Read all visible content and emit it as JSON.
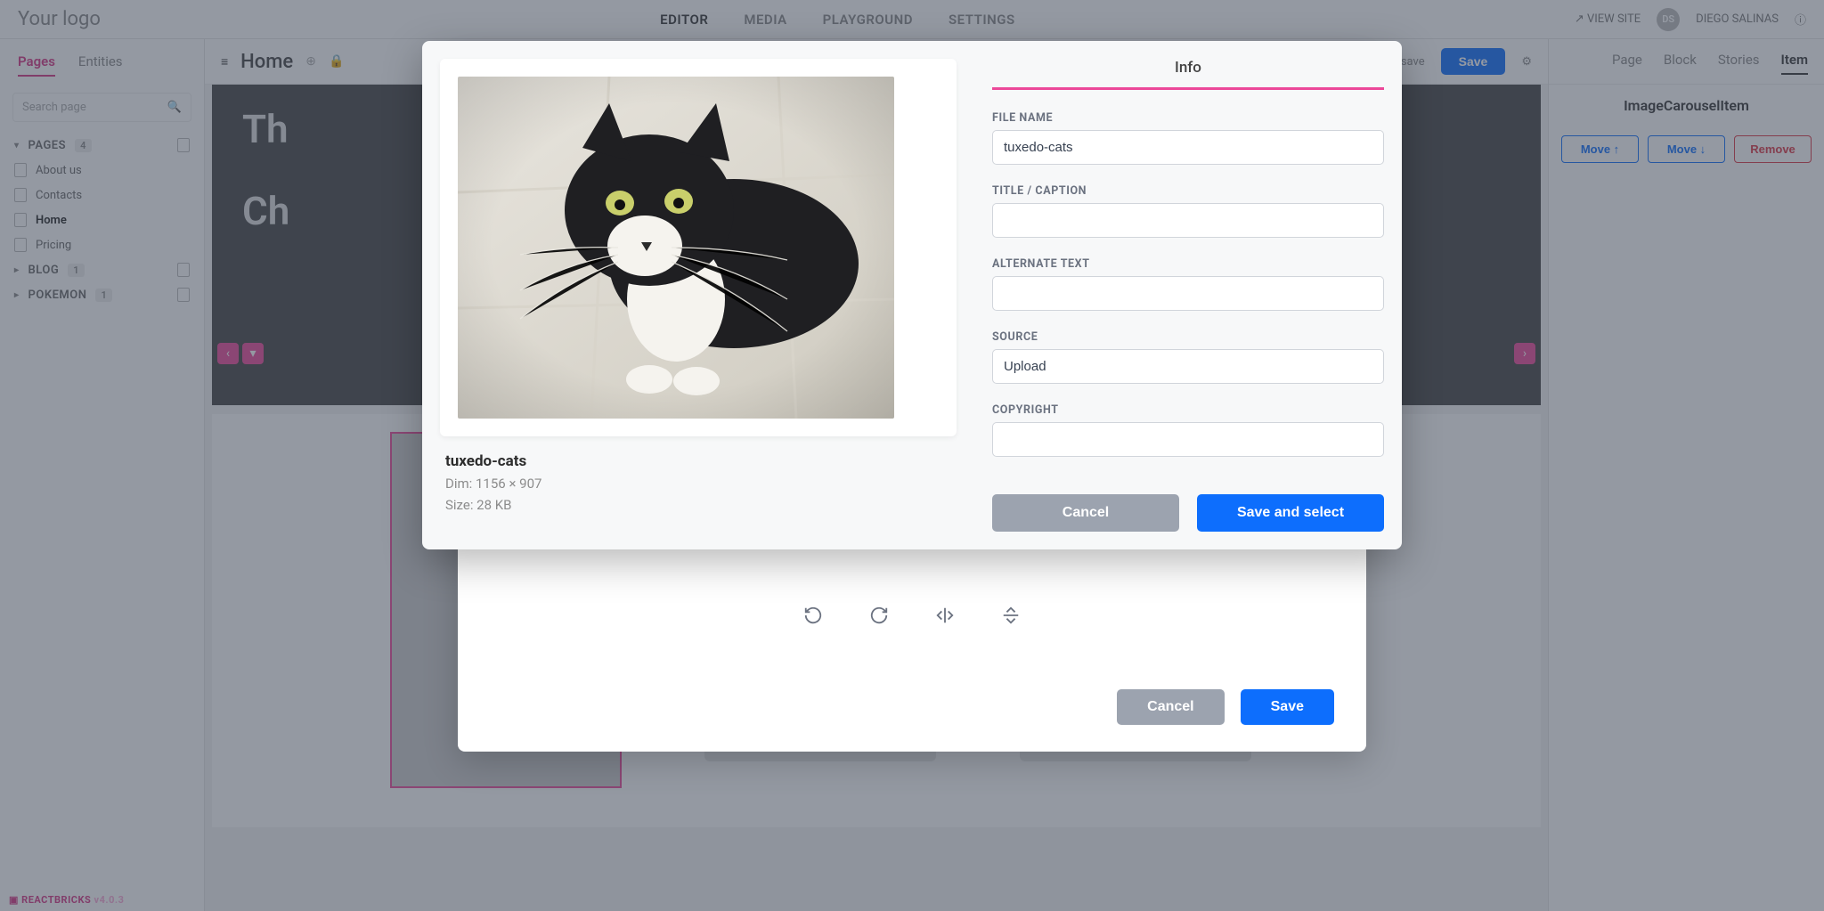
{
  "top": {
    "logo": "Your logo",
    "nav": [
      "EDITOR",
      "MEDIA",
      "PLAYGROUND",
      "SETTINGS"
    ],
    "nav_active": 0,
    "view_site": "VIEW SITE",
    "user_initials": "DS",
    "user_name": "DIEGO SALINAS"
  },
  "sidebar": {
    "tabs": [
      "Pages",
      "Entities"
    ],
    "search_placeholder": "Search page",
    "sections": [
      {
        "label": "PAGES",
        "count": "4",
        "expandable": true,
        "open": true
      },
      {
        "label": "About us"
      },
      {
        "label": "Contacts"
      },
      {
        "label": "Home",
        "selected": true
      },
      {
        "label": "Pricing"
      },
      {
        "label": "BLOG",
        "count": "1",
        "expandable": true
      },
      {
        "label": "POKEMON",
        "count": "1",
        "expandable": true
      }
    ]
  },
  "canvas": {
    "burger": "≡",
    "title": "Home",
    "autosave": "Autosave",
    "save": "Save",
    "hero_line1": "Th",
    "hero_line2": "Ch"
  },
  "rightpanel": {
    "tabs": [
      "Page",
      "Block",
      "Stories",
      "Item"
    ],
    "title": "ImageCarouselItem",
    "move_up": "Move ↑",
    "move_down": "Move ↓",
    "remove": "Remove"
  },
  "under_modal": {
    "cancel": "Cancel",
    "save": "Save"
  },
  "modal": {
    "info_tab": "Info",
    "image_name": "tuxedo-cats",
    "dim": "Dim: 1156 × 907",
    "size": "Size: 28 KB",
    "fields": {
      "file_name": {
        "label": "FILE NAME",
        "value": "tuxedo-cats"
      },
      "title": {
        "label": "TITLE / CAPTION",
        "value": ""
      },
      "alt": {
        "label": "ALTERNATE TEXT",
        "value": ""
      },
      "source": {
        "label": "SOURCE",
        "value": "Upload"
      },
      "copyright": {
        "label": "COPYRIGHT",
        "value": ""
      }
    },
    "cancel": "Cancel",
    "save_select": "Save and select"
  },
  "footer": {
    "brand": "REACTBRICKS",
    "version": "v4.0.3"
  }
}
